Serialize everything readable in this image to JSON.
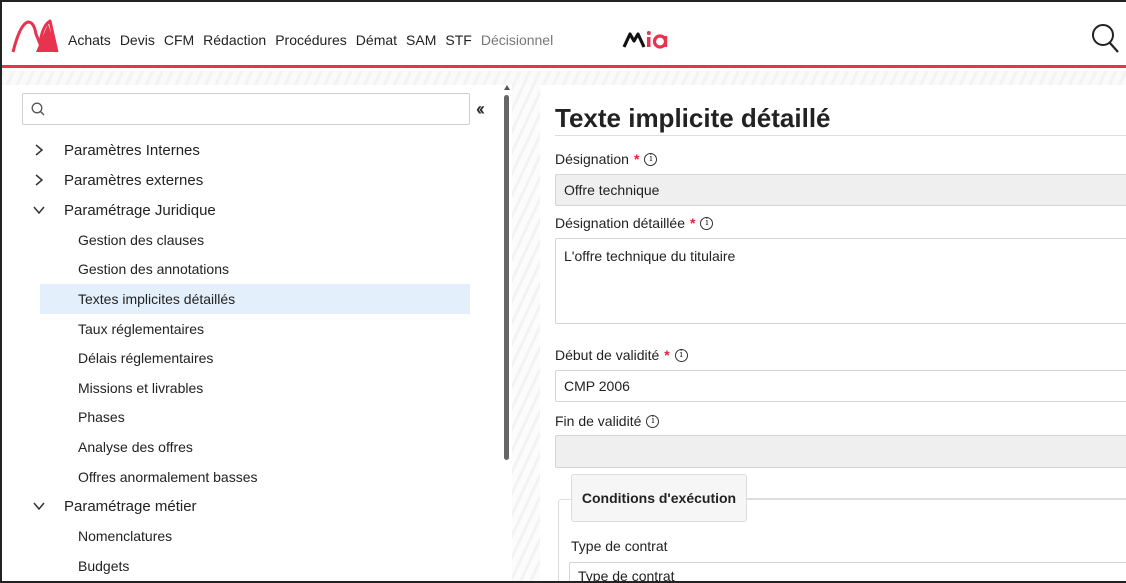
{
  "nav": {
    "items": [
      "Achats",
      "Devis",
      "CFM",
      "Rédaction",
      "Procédures",
      "Démat",
      "SAM",
      "STF"
    ],
    "dim_item": "Décisionnel",
    "brand_word": "MIA",
    "accent_color": "#e8334f"
  },
  "sidebar": {
    "search_placeholder": "",
    "collapse_icon": "double-chevron-left-icon",
    "tree": [
      {
        "label": "Paramètres Internes",
        "expanded": false,
        "children": []
      },
      {
        "label": "Paramètres externes",
        "expanded": false,
        "children": []
      },
      {
        "label": "Paramétrage Juridique",
        "expanded": true,
        "children": [
          "Gestion des clauses",
          "Gestion des annotations",
          "Textes implicites détaillés",
          "Taux réglementaires",
          "Délais réglementaires",
          "Missions et livrables",
          "Phases",
          "Analyse des offres",
          "Offres anormalement basses"
        ]
      },
      {
        "label": "Paramétrage métier",
        "expanded": true,
        "children": [
          "Nomenclatures",
          "Budgets"
        ]
      }
    ],
    "active_item": "Textes implicites détaillés",
    "active_color": "#e3f0fb"
  },
  "main": {
    "title": "Texte implicite détaillé",
    "fields": {
      "designation": {
        "label": "Désignation",
        "required": "*",
        "value": "Offre technique"
      },
      "designation_detaillee": {
        "label": "Désignation détaillée",
        "required": "*",
        "value": "L'offre technique du titulaire"
      },
      "debut_validite": {
        "label": "Début de validité",
        "required": "*",
        "value": "CMP 2006"
      },
      "fin_validite": {
        "label": "Fin de validité",
        "value": ""
      }
    },
    "conditions": {
      "tab_label": "Conditions d'exécution",
      "type_contrat_label": "Type de contrat",
      "type_contrat_placeholder": "Type de contrat"
    }
  }
}
